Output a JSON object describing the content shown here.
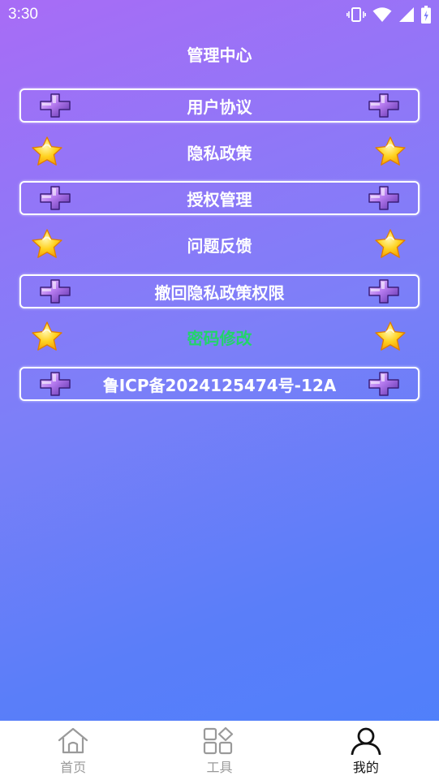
{
  "status_bar": {
    "time": "3:30",
    "icons": [
      "vibrate-icon",
      "wifi-icon",
      "signal-icon",
      "battery-icon"
    ]
  },
  "header": {
    "title": "管理中心"
  },
  "menu": {
    "items": [
      {
        "label": "用户协议",
        "style": "boxed",
        "icon": "purple-cross-icon"
      },
      {
        "label": "隐私政策",
        "style": "starred",
        "icon": "star-icon"
      },
      {
        "label": "授权管理",
        "style": "boxed",
        "icon": "purple-cross-icon"
      },
      {
        "label": "问题反馈",
        "style": "starred",
        "icon": "star-icon"
      },
      {
        "label": "撤回隐私政策权限",
        "style": "boxed",
        "icon": "purple-cross-icon"
      },
      {
        "label": "密码修改",
        "style": "starred",
        "icon": "star-icon",
        "color": "#22d46a"
      },
      {
        "label": "鲁ICP备2024125474号-12A",
        "style": "boxed",
        "icon": "purple-cross-icon"
      }
    ]
  },
  "bottom_nav": {
    "items": [
      {
        "label": "首页",
        "icon": "home-icon",
        "active": false
      },
      {
        "label": "工具",
        "icon": "tools-grid-icon",
        "active": false
      },
      {
        "label": "我的",
        "icon": "user-icon",
        "active": true
      }
    ]
  },
  "colors": {
    "gradient_start": "#a86cf6",
    "gradient_end": "#4d80fb",
    "highlight_text": "#22d46a",
    "nav_inactive": "#9a9a9a",
    "nav_active": "#111111"
  }
}
